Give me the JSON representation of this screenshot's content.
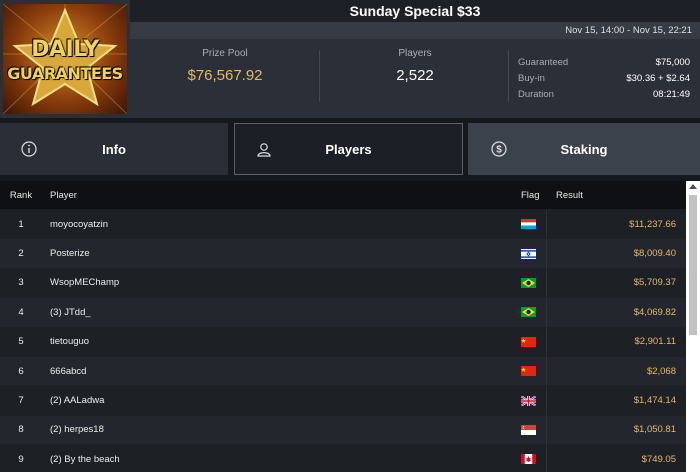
{
  "header": {
    "logo_text_line1": "DAILY",
    "logo_text_line2": "GUARANTEES",
    "title": "Sunday Special $33",
    "dates": "Nov 15, 14:00 - Nov 15, 22:21",
    "prize_pool_label": "Prize Pool",
    "prize_pool_value": "$76,567.92",
    "players_label": "Players",
    "players_value": "2,522",
    "details": {
      "guaranteed_label": "Guaranteed",
      "guaranteed_value": "$75,000",
      "buyin_label": "Buy-in",
      "buyin_value": "$30.36 + $2.64",
      "duration_label": "Duration",
      "duration_value": "08:21:49"
    }
  },
  "tabs": {
    "info": "Info",
    "players": "Players",
    "staking": "Staking",
    "active": "players"
  },
  "table": {
    "columns": {
      "rank": "Rank",
      "player": "Player",
      "flag": "Flag",
      "result": "Result"
    },
    "rows": [
      {
        "rank": "1",
        "player": "moyocoyatzin",
        "flag": "luxembourg",
        "result": "$11,237.66"
      },
      {
        "rank": "2",
        "player": "Posterize",
        "flag": "israel",
        "result": "$8,009.40"
      },
      {
        "rank": "3",
        "player": "WsopMEChamp",
        "flag": "brazil",
        "result": "$5,709.37"
      },
      {
        "rank": "4",
        "player": "(3) JTdd_",
        "flag": "brazil",
        "result": "$4,069.82"
      },
      {
        "rank": "5",
        "player": "tietouguo",
        "flag": "china",
        "result": "$2,901.11"
      },
      {
        "rank": "6",
        "player": "666abcd",
        "flag": "china",
        "result": "$2,068"
      },
      {
        "rank": "7",
        "player": "(2) AALadwa",
        "flag": "united-kingdom",
        "result": "$1,474.14"
      },
      {
        "rank": "8",
        "player": "(2) herpes18",
        "flag": "singapore",
        "result": "$1,050.81"
      },
      {
        "rank": "9",
        "player": "(2) By the beach",
        "flag": "canada",
        "result": "$749.05"
      }
    ]
  },
  "colors": {
    "accent_gold": "#e6b86a",
    "background": "#15181d",
    "header_bg": "#2b3038"
  }
}
